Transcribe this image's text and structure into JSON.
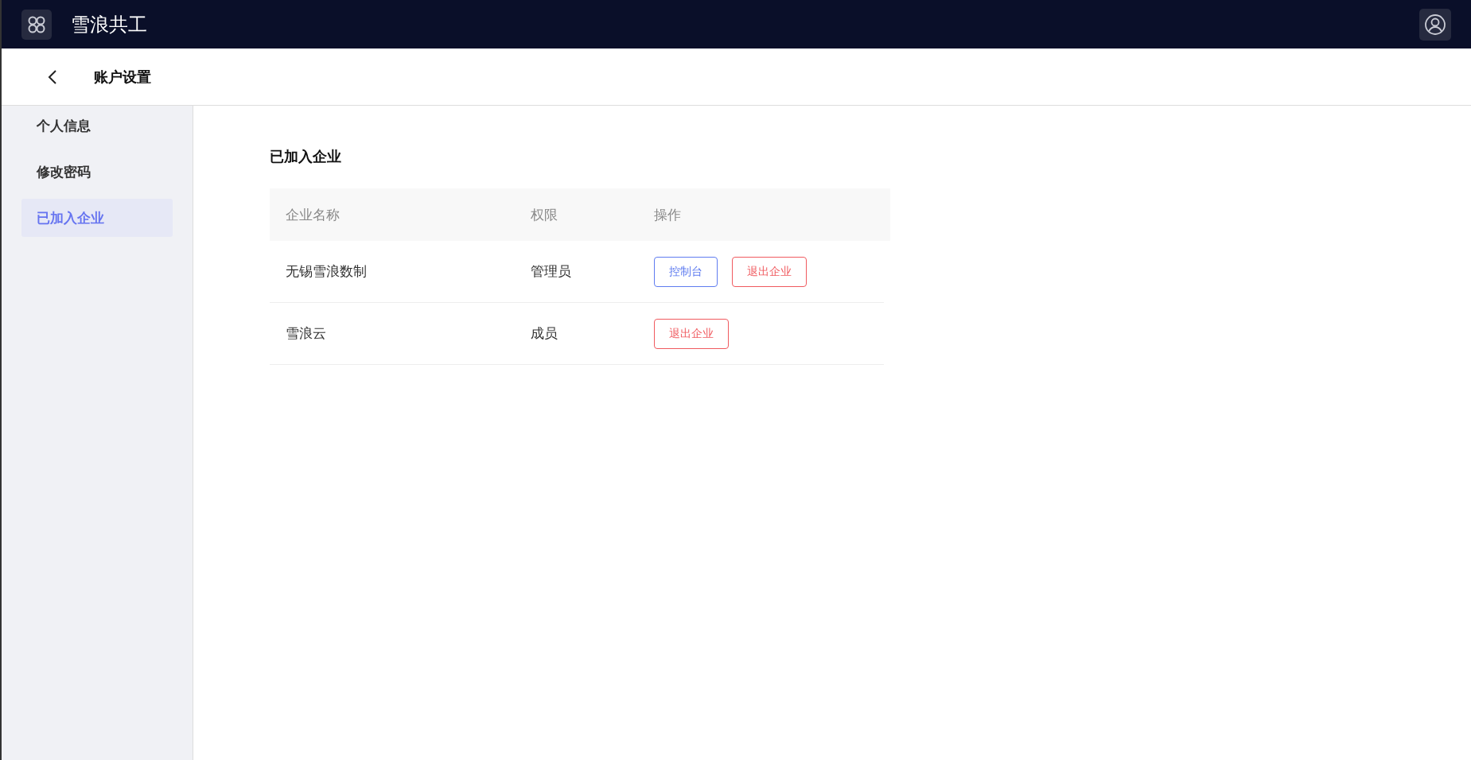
{
  "app": {
    "title": "雪浪共工"
  },
  "page": {
    "title": "账户设置"
  },
  "sidebar": {
    "items": [
      {
        "label": "个人信息",
        "selected": false
      },
      {
        "label": "修改密码",
        "selected": false
      },
      {
        "label": "已加入企业",
        "selected": true
      }
    ]
  },
  "section": {
    "title": "已加入企业"
  },
  "table": {
    "columns": [
      "企业名称",
      "权限",
      "操作"
    ],
    "rows": [
      {
        "name": "无锡雪浪数制",
        "role": "管理员",
        "actions": [
          {
            "label": "控制台",
            "kind": "primary"
          },
          {
            "label": "退出企业",
            "kind": "danger"
          }
        ]
      },
      {
        "name": "雪浪云",
        "role": "成员",
        "actions": [
          {
            "label": "退出企业",
            "kind": "danger"
          }
        ]
      }
    ]
  }
}
